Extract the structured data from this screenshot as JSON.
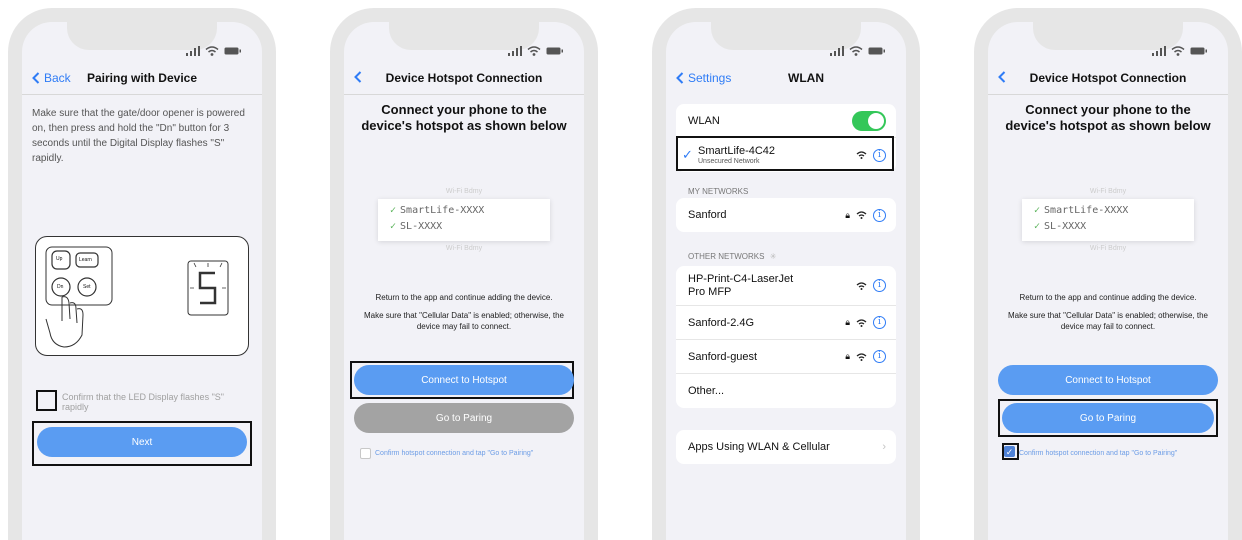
{
  "phone1": {
    "nav": {
      "back_label": "Back",
      "title": "Pairing with Device"
    },
    "instruction": "Make sure that the gate/door opener is powered on, then press and hold the \"Dn\" button for 3 seconds until the Digital Display flashes \"S\" rapidly.",
    "keypad": {
      "key_up": "Up",
      "key_learn": "Learn",
      "key_dn": "Dn",
      "key_set": "Set",
      "display_char": "S"
    },
    "confirm_label": "Confirm that the LED Display flashes \"S\" rapidly",
    "next_button": "Next"
  },
  "phone2": {
    "nav": {
      "title": "Device Hotspot Connection"
    },
    "heading": "Connect your phone to the device's hotspot as shown below",
    "wifi_faded_top": "Wi-Fi  Bdmy",
    "wifi_items": [
      "SmartLife-XXXX",
      "SL-XXXX"
    ],
    "wifi_faded_bottom": "Wi-Fi  Bdmy",
    "return_text": "Return to the app and continue adding the device.",
    "warning_text": "Make sure that \"Cellular Data\" is enabled; otherwise, the device may fail to connect.",
    "connect_button": "Connect to Hotspot",
    "pairing_button": "Go to Paring",
    "confirm_label": "Confirm hotspot connection and tap \"Go to Pairing\""
  },
  "phone3": {
    "nav": {
      "back_label": "Settings",
      "title": "WLAN"
    },
    "wlan_label": "WLAN",
    "connected_network": {
      "name": "SmartLife-4C42",
      "subtitle": "Unsecured Network"
    },
    "my_networks_label": "MY NETWORKS",
    "my_networks": [
      "Sanford"
    ],
    "other_networks_label": "OTHER NETWORKS",
    "other_networks": [
      "HP-Print-C4-LaserJet Pro MFP",
      "Sanford-2.4G",
      "Sanford-guest",
      "Other..."
    ],
    "apps_label": "Apps Using WLAN & Cellular"
  },
  "phone4": {
    "nav": {
      "title": "Device Hotspot Connection"
    },
    "heading": "Connect your phone to the device's hotspot as shown below",
    "wifi_faded_top": "Wi-Fi  Bdmy",
    "wifi_items": [
      "SmartLife-XXXX",
      "SL-XXXX"
    ],
    "wifi_faded_bottom": "Wi-Fi  Bdmy",
    "return_text": "Return to the app and continue adding the device.",
    "warning_text": "Make sure that \"Cellular Data\" is enabled; otherwise, the device may fail to connect.",
    "connect_button": "Connect to Hotspot",
    "pairing_button": "Go to Paring",
    "confirm_label": "Confirm hotspot connection and tap \"Go to Pairing\""
  },
  "colors": {
    "ios_blue": "#2f7cf6",
    "button_blue": "#5a9cf2",
    "button_gray": "#a3a3a3",
    "toggle_green": "#34c759",
    "checkbox_blue": "#4f82d6"
  }
}
